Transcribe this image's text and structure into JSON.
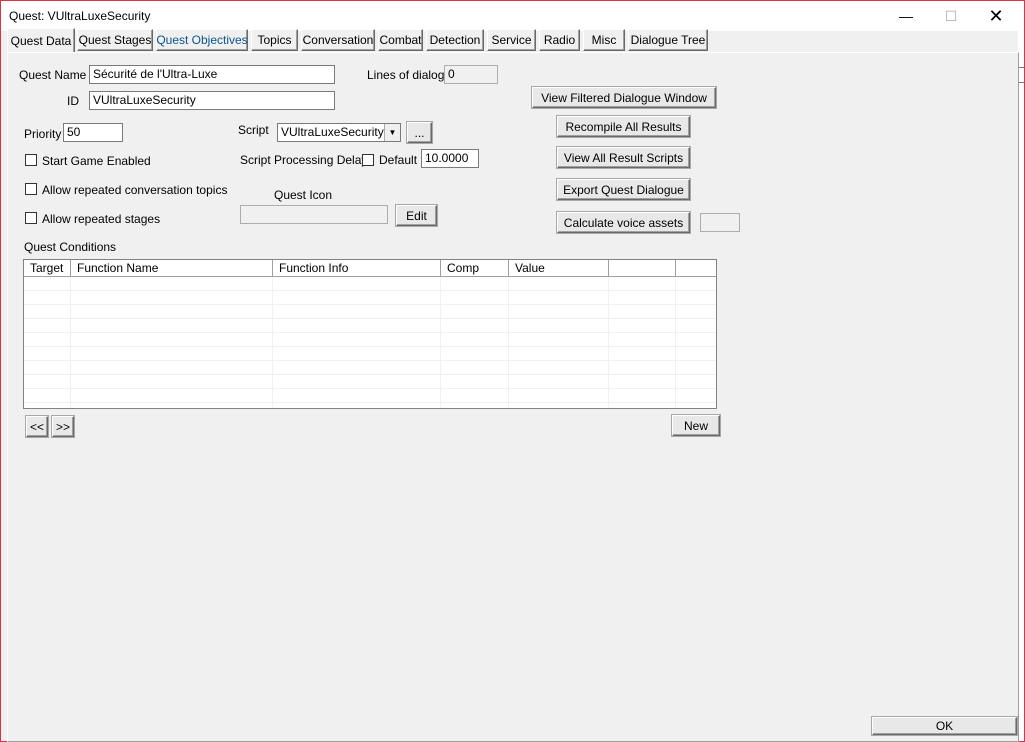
{
  "window": {
    "title": "Quest: VUltraLuxeSecurity",
    "min_glyph": "—",
    "max_glyph": "☐",
    "close_glyph": "✕"
  },
  "tabs": [
    {
      "label": "Quest Data",
      "active": true
    },
    {
      "label": "Quest Stages"
    },
    {
      "label": "Quest Objectives",
      "highlight": true
    },
    {
      "label": "Topics"
    },
    {
      "label": "Conversation"
    },
    {
      "label": "Combat"
    },
    {
      "label": "Detection"
    },
    {
      "label": "Service"
    },
    {
      "label": "Radio"
    },
    {
      "label": "Misc"
    },
    {
      "label": "Dialogue Tree"
    }
  ],
  "quest": {
    "name_label": "Quest Name",
    "name_value": "Sécurité de l'Ultra-Luxe",
    "id_label": "ID",
    "id_value": "VUltraLuxeSecurity",
    "lines_label": "Lines of dialog:",
    "lines_value": "0",
    "priority_label": "Priority",
    "priority_value": "50",
    "script_label": "Script",
    "script_value": "VUltraLuxeSecuritySC",
    "script_browse": "...",
    "delay_label": "Script Processing Delay",
    "default_label": "Default",
    "delay_value": "10.0000",
    "start_enabled_label": "Start Game Enabled",
    "repeat_topics_label": "Allow repeated conversation topics",
    "repeat_stages_label": "Allow repeated stages",
    "icon_label": "Quest Icon",
    "icon_value": "",
    "edit_button": "Edit"
  },
  "actions": {
    "view_filtered": "View Filtered Dialogue Window",
    "recompile": "Recompile All Results",
    "view_scripts": "View All Result Scripts",
    "export": "Export Quest Dialogue",
    "calc_voice": "Calculate voice assets",
    "voice_value": ""
  },
  "conditions": {
    "label": "Quest Conditions",
    "columns": [
      "Target",
      "Function Name",
      "Function Info",
      "Comp",
      "Value",
      "",
      ""
    ],
    "rows": [],
    "prev_button": "<<",
    "next_button": ">>",
    "new_button": "New"
  },
  "footer": {
    "ok_button": "OK"
  }
}
